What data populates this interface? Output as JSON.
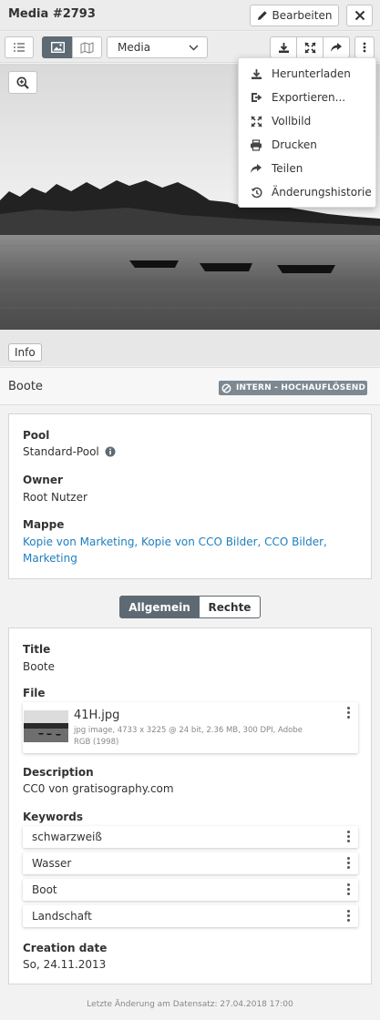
{
  "window": {
    "title": "Media #2793",
    "edit_label": "Bearbeiten"
  },
  "toolbar": {
    "view_select": "Media"
  },
  "menu": {
    "items": [
      {
        "label": "Herunterladen",
        "icon": "download-icon"
      },
      {
        "label": "Exportieren...",
        "icon": "export-icon"
      },
      {
        "label": "Vollbild",
        "icon": "fullscreen-icon"
      },
      {
        "label": "Drucken",
        "icon": "print-icon"
      },
      {
        "label": "Teilen",
        "icon": "share-icon"
      },
      {
        "label": "Änderungshistorie",
        "icon": "history-icon"
      }
    ]
  },
  "info_tab": "Info",
  "record": {
    "name": "Boote",
    "badge": "INTERN - HOCHAUFLÖSEND"
  },
  "meta": {
    "pool_label": "Pool",
    "pool_value": "Standard-Pool",
    "owner_label": "Owner",
    "owner_value": "Root Nutzer",
    "folder_label": "Mappe",
    "folder_line1": "Kopie von Marketing, Kopie von CCO Bilder, CCO Bilder,",
    "folder_line2": "Marketing"
  },
  "tabs": {
    "general": "Allgemein",
    "rights": "Rechte"
  },
  "details": {
    "title_label": "Title",
    "title_value": "Boote",
    "file_label": "File",
    "file_name": "41H.jpg",
    "file_info_line1": "jpg image,  4733 x 3225 @ 24 bit,  2.36 MB,  300 DPI,  Adobe",
    "file_info_line2": "RGB (1998)",
    "description_label": "Description",
    "description_value": "CC0 von gratisography.com",
    "keywords_label": "Keywords",
    "keywords": [
      "schwarzweiß",
      "Wasser",
      "Boot",
      "Landschaft"
    ],
    "creation_label": "Creation date",
    "creation_value": "So, 24.11.2013"
  },
  "footer": "Letzte Änderung am Datensatz: 27.04.2018 17:00",
  "colors": {
    "accent": "#5e6a73",
    "link": "#1d7fbf",
    "badge": "#7d8891"
  }
}
